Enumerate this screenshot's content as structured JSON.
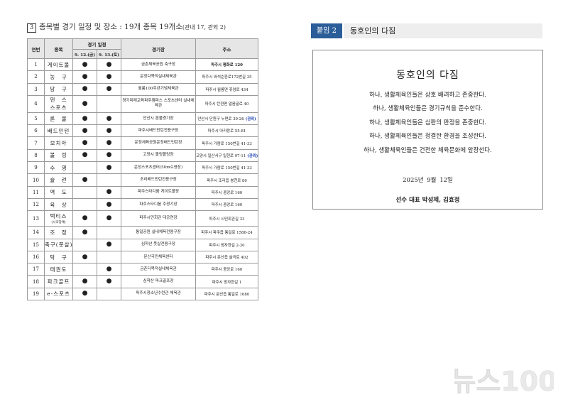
{
  "left": {
    "heading_num": "3",
    "heading_main": "종목별 경기 일정 및 장소 : 19개 종목 19개소",
    "heading_sub": "(관내 17, 관외 2)",
    "columns": {
      "no": "연번",
      "sport": "종목",
      "schedule": "경기 일정",
      "day1": "9. 12.(금)",
      "day2": "9. 13.(토)",
      "venue": "경기장",
      "address": "주소"
    },
    "rows": [
      {
        "no": "1",
        "sport": "게이트볼",
        "d1": "●",
        "d2": "●",
        "venue": "금촌체육공원 축구장",
        "addr": "파주시 평화로 120",
        "tag": ""
      },
      {
        "no": "2",
        "sport": "농　구",
        "d1": "●",
        "d2": "●",
        "venue": "운정다목적실내체육관",
        "addr": "파주시 와석순환로172번길 35",
        "tag": ""
      },
      {
        "no": "3",
        "sport": "당　구",
        "d1": "●",
        "d2": "●",
        "venue": "월롱100주년기념체육관",
        "addr": "파주시 월롱면 휴암로 434",
        "tag": ""
      },
      {
        "no": "4",
        "sport": "댄　스",
        "sport2": "스포츠",
        "d1": "●",
        "d2": "",
        "venue": "경기미래교육파주캠퍼스 스포츠센터 실내체육관",
        "addr": "파주시 탄현면 얼음골로 40",
        "tag": ""
      },
      {
        "no": "5",
        "sport": "론　볼",
        "d1": "●",
        "d2": "●",
        "venue": "안산시 론볼경기장",
        "addr": "안산시 단원구 누면로 39-26",
        "tag": "(관외)"
      },
      {
        "no": "6",
        "sport": "배드민턴",
        "d1": "●",
        "d2": "●",
        "venue": "파주시배드민턴전용구장",
        "addr": "파주시 아리랑로 55-81",
        "tag": ""
      },
      {
        "no": "7",
        "sport": "보치아",
        "d1": "●",
        "d2": "●",
        "venue": "운정체육공원운정배드민턴장",
        "addr": "파주시 가람로 150번길 41-33",
        "tag": ""
      },
      {
        "no": "8",
        "sport": "볼　링",
        "d1": "●",
        "d2": "●",
        "venue": "고양시 볼링볼링장",
        "addr": "고양시 일산서구 일현로 97-11",
        "tag": "(관외)"
      },
      {
        "no": "9",
        "sport": "수　영",
        "d1": "",
        "d2": "●",
        "venue": "운정스포츠센터(50m수영장)",
        "addr": "파주시 가람로 150번길 41-33",
        "tag": ""
      },
      {
        "no": "10",
        "sport": "슐　런",
        "d1": "●",
        "d2": "",
        "venue": "조리배드민턴전용구장",
        "addr": "파주시 조리읍 봉천로 80",
        "tag": ""
      },
      {
        "no": "11",
        "sport": "역　도",
        "d1": "",
        "d2": "●",
        "venue": "파주스타디움 게이트볼장",
        "addr": "파주시 중앙로 160",
        "tag": ""
      },
      {
        "no": "12",
        "sport": "육　상",
        "d1": "",
        "d2": "●",
        "venue": "파주스타디움 주경기장",
        "addr": "파주시 중앙로 160",
        "tag": ""
      },
      {
        "no": "13",
        "sport": "택티스",
        "sport2": "(시각장애)",
        "d1": "●",
        "d2": "●",
        "venue": "파주시민회관 대공연장",
        "addr": "파주시 시민회관길 33",
        "tag": ""
      },
      {
        "no": "14",
        "sport": "조　정",
        "d1": "●",
        "d2": "",
        "venue": "통일공원 실내체육전용구장",
        "addr": "파주시 파주읍 통일로 1586-24",
        "tag": ""
      },
      {
        "no": "15",
        "sport": "축구(풋살)",
        "d1": "",
        "d2": "●",
        "venue": "심학산 풋살전용구장",
        "addr": "파주시 방자한길 2-30",
        "tag": ""
      },
      {
        "no": "16",
        "sport": "탁　구",
        "d1": "●",
        "d2": "",
        "venue": "문산국민체육센터",
        "addr": "파주시 문산읍 술곡로 402",
        "tag": ""
      },
      {
        "no": "17",
        "sport": "태권도",
        "d1": "",
        "d2": "●",
        "venue": "금촌다목적실내체육관",
        "addr": "파주시 중앙로 160",
        "tag": ""
      },
      {
        "no": "18",
        "sport": "파크골프",
        "d1": "●",
        "d2": "●",
        "venue": "심학산 파크골프장",
        "addr": "파주시 방자한길 1",
        "tag": ""
      },
      {
        "no": "19",
        "sport": "e-스포츠",
        "d1": "●",
        "d2": "",
        "venue": "파주시청소년수련관 체육관",
        "addr": "파주시 문산읍 통일로 1680",
        "tag": ""
      }
    ]
  },
  "right": {
    "tab_label": "붙임 2",
    "tab_title": "동호인의 다짐",
    "pledge_title": "동호인의 다짐",
    "lines": [
      "하나, 생활체육인들은 상호 배려하고 존중한다.",
      "하나, 생활체육인들은 경기규칙을 준수한다.",
      "하나, 생활체육인들은 심판의 판정을 존중한다.",
      "하나, 생활체육인들은 청결한 환경을 조성한다.",
      "하나, 생활체육인들은 건전한 체육문화에 앞장선다."
    ],
    "date": "2025년 9월 12일",
    "signature": "선수 대표 박성제, 김효정"
  },
  "watermark": {
    "text": "뉴스100",
    "color": "#e9e9e9"
  }
}
